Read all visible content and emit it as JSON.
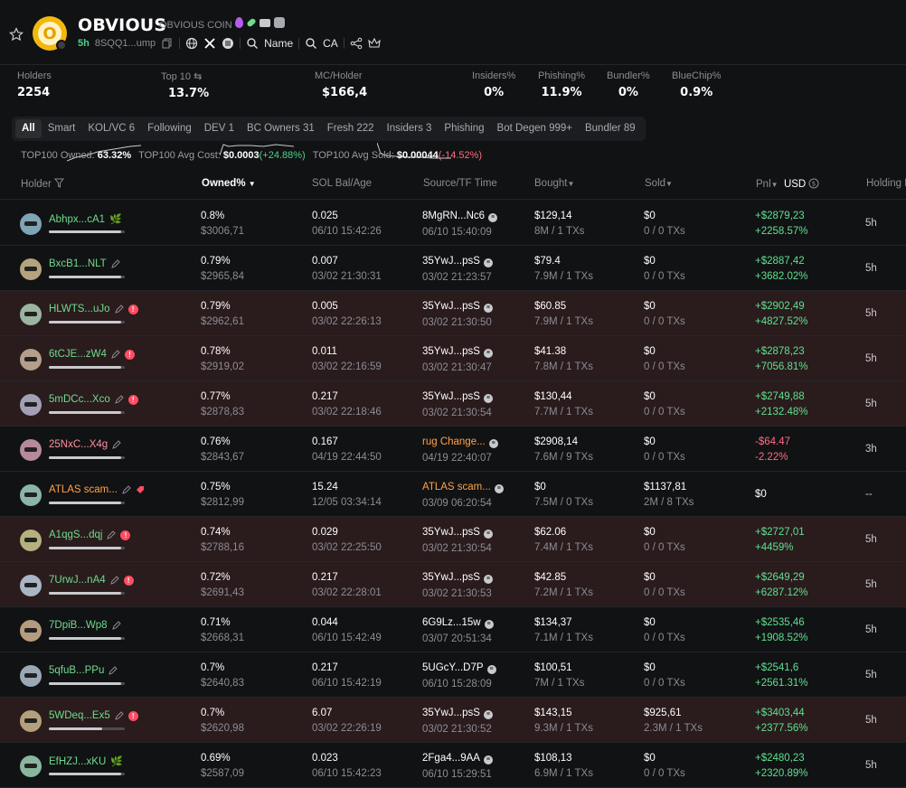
{
  "token": {
    "name": "OBVIOUS",
    "subtitle": "OBVIOUS COIN",
    "logo_letter": "O",
    "age": "5h",
    "address": "8SQQ1...ump",
    "links": {
      "name_label": "Name",
      "ca_label": "CA"
    }
  },
  "stats": {
    "holders": {
      "label": "Holders",
      "value": "2254"
    },
    "top10": {
      "label": "Top 10",
      "value": "13.7%"
    },
    "mc_holder": {
      "label": "MC/Holder",
      "value": "$166,4"
    },
    "insiders": {
      "label": "Insiders%",
      "value": "0%"
    },
    "phishing": {
      "label": "Phishing%",
      "value": "11.9%"
    },
    "bundler": {
      "label": "Bundler%",
      "value": "0%"
    },
    "bluechip": {
      "label": "BlueChip%",
      "value": "0.9%"
    }
  },
  "tabs": [
    "All",
    "Smart",
    "KOL/VC 6",
    "Following",
    "DEV 1",
    "BC Owners 31",
    "Fresh 222",
    "Insiders 3",
    "Phishing",
    "Bot Degen 999+",
    "Bundler 89"
  ],
  "summary": {
    "owned_label": "TOP100 Owned:",
    "owned_value": "63.32%",
    "avgcost_label": "TOP100 Avg Cost:",
    "avgcost_value": "$0.0003",
    "avgcost_change": "(+24.88%)",
    "avgsold_label": "TOP100 Avg Sold:",
    "avgsold_value": "$0.00044",
    "avgsold_change": "(-14.52%)"
  },
  "columns": {
    "holder": "Holder",
    "owned": "Owned%",
    "sol": "SOL Bal/Age",
    "source": "Source/TF Time",
    "bought": "Bought",
    "sold": "Sold",
    "pnl": "Pnl",
    "usd": "USD",
    "holding": "Holding Pe"
  },
  "rows": [
    {
      "name": "Abhpx...cA1",
      "color": "green",
      "badge": "leaf",
      "red": false,
      "bar": 0.95,
      "owned": "0.8%",
      "owned_usd": "$3006,71",
      "sol": "0.025",
      "sol_age": "06/10 15:42:26",
      "src": "8MgRN...Nc6",
      "src_color": "",
      "src_time": "06/10 15:40:09",
      "bought": "$129,14",
      "bought_sub": "8M / 1 TXs",
      "sold": "$0",
      "sold_sub": "0 / 0 TXs",
      "pnl": "+$2879,23",
      "pnl_pct": "+2258.57%",
      "pnl_color": "g",
      "hold": "5h"
    },
    {
      "name": "BxcB1...NLT",
      "color": "green",
      "badge": "pen",
      "red": false,
      "bar": 0.95,
      "owned": "0.79%",
      "owned_usd": "$2965,84",
      "sol": "0.007",
      "sol_age": "03/02 21:30:31",
      "src": "35YwJ...psS",
      "src_color": "",
      "src_time": "03/02 21:23:57",
      "bought": "$79.4",
      "bought_sub": "7.9M / 1 TXs",
      "sold": "$0",
      "sold_sub": "0 / 0 TXs",
      "pnl": "+$2887,42",
      "pnl_pct": "+3682.02%",
      "pnl_color": "g",
      "hold": "5h"
    },
    {
      "name": "HLWTS...uJo",
      "color": "green",
      "badge": "flag",
      "red": true,
      "bar": 0.95,
      "owned": "0.79%",
      "owned_usd": "$2962,61",
      "sol": "0.005",
      "sol_age": "03/02 22:26:13",
      "src": "35YwJ...psS",
      "src_color": "",
      "src_time": "03/02 21:30:50",
      "bought": "$60.85",
      "bought_sub": "7.9M / 1 TXs",
      "sold": "$0",
      "sold_sub": "0 / 0 TXs",
      "pnl": "+$2902,49",
      "pnl_pct": "+4827.52%",
      "pnl_color": "g",
      "hold": "5h"
    },
    {
      "name": "6tCJE...zW4",
      "color": "green",
      "badge": "flag",
      "red": true,
      "bar": 0.95,
      "owned": "0.78%",
      "owned_usd": "$2919,02",
      "sol": "0.011",
      "sol_age": "03/02 22:16:59",
      "src": "35YwJ...psS",
      "src_color": "",
      "src_time": "03/02 21:30:47",
      "bought": "$41.38",
      "bought_sub": "7.8M / 1 TXs",
      "sold": "$0",
      "sold_sub": "0 / 0 TXs",
      "pnl": "+$2878,23",
      "pnl_pct": "+7056.81%",
      "pnl_color": "g",
      "hold": "5h"
    },
    {
      "name": "5mDCc...Xco",
      "color": "green",
      "badge": "flag",
      "red": true,
      "bar": 0.95,
      "owned": "0.77%",
      "owned_usd": "$2878,83",
      "sol": "0.217",
      "sol_age": "03/02 22:18:46",
      "src": "35YwJ...psS",
      "src_color": "",
      "src_time": "03/02 21:30:54",
      "bought": "$130,44",
      "bought_sub": "7.7M / 1 TXs",
      "sold": "$0",
      "sold_sub": "0 / 0 TXs",
      "pnl": "+$2749,88",
      "pnl_pct": "+2132.48%",
      "pnl_color": "g",
      "hold": "5h"
    },
    {
      "name": "25NxC...X4g",
      "color": "pink",
      "badge": "pen",
      "red": false,
      "bar": 0.95,
      "owned": "0.76%",
      "owned_usd": "$2843,67",
      "sol": "0.167",
      "sol_age": "04/19 22:44:50",
      "src": "rug Change...",
      "src_color": "o",
      "src_time": "04/19 22:40:07",
      "bought": "$2908,14",
      "bought_sub": "7.6M / 9 TXs",
      "sold": "$0",
      "sold_sub": "0 / 0 TXs",
      "pnl": "-$64.47",
      "pnl_pct": "-2.22%",
      "pnl_color": "r",
      "hold": "3h"
    },
    {
      "name": "ATLAS scam...",
      "color": "orange",
      "badge": "tag",
      "red": false,
      "bar": 0.95,
      "owned": "0.75%",
      "owned_usd": "$2812,99",
      "sol": "15.24",
      "sol_age": "12/05 03:34:14",
      "src": "ATLAS scam...",
      "src_color": "o",
      "src_time": "03/09 06:20:54",
      "bought": "$0",
      "bought_sub": "7.5M / 0 TXs",
      "sold": "$1137,81",
      "sold_sub": "2M / 8 TXs",
      "pnl": "$0",
      "pnl_pct": "",
      "pnl_color": "",
      "hold": "--"
    },
    {
      "name": "A1qgS...dqj",
      "color": "green",
      "badge": "flag",
      "red": true,
      "bar": 0.95,
      "owned": "0.74%",
      "owned_usd": "$2788,16",
      "sol": "0.029",
      "sol_age": "03/02 22:25:50",
      "src": "35YwJ...psS",
      "src_color": "",
      "src_time": "03/02 21:30:54",
      "bought": "$62.06",
      "bought_sub": "7.4M / 1 TXs",
      "sold": "$0",
      "sold_sub": "0 / 0 TXs",
      "pnl": "+$2727,01",
      "pnl_pct": "+4459%",
      "pnl_color": "g",
      "hold": "5h"
    },
    {
      "name": "7UrwJ...nA4",
      "color": "green",
      "badge": "flag",
      "red": true,
      "bar": 0.95,
      "owned": "0.72%",
      "owned_usd": "$2691,43",
      "sol": "0.217",
      "sol_age": "03/02 22:28:01",
      "src": "35YwJ...psS",
      "src_color": "",
      "src_time": "03/02 21:30:53",
      "bought": "$42.85",
      "bought_sub": "7.2M / 1 TXs",
      "sold": "$0",
      "sold_sub": "0 / 0 TXs",
      "pnl": "+$2649,29",
      "pnl_pct": "+6287.12%",
      "pnl_color": "g",
      "hold": "5h"
    },
    {
      "name": "7DpiB...Wp8",
      "color": "green",
      "badge": "pen",
      "red": false,
      "bar": 0.95,
      "owned": "0.71%",
      "owned_usd": "$2668,31",
      "sol": "0.044",
      "sol_age": "06/10 15:42:49",
      "src": "6G9Lz...15w",
      "src_color": "",
      "src_time": "03/07 20:51:34",
      "bought": "$134,37",
      "bought_sub": "7.1M / 1 TXs",
      "sold": "$0",
      "sold_sub": "0 / 0 TXs",
      "pnl": "+$2535,46",
      "pnl_pct": "+1908.52%",
      "pnl_color": "g",
      "hold": "5h"
    },
    {
      "name": "5qfuB...PPu",
      "color": "green",
      "badge": "pen",
      "red": false,
      "bar": 0.95,
      "owned": "0.7%",
      "owned_usd": "$2640,83",
      "sol": "0.217",
      "sol_age": "06/10 15:42:19",
      "src": "5UGcY...D7P",
      "src_color": "",
      "src_time": "06/10 15:28:09",
      "bought": "$100,51",
      "bought_sub": "7M / 1 TXs",
      "sold": "$0",
      "sold_sub": "0 / 0 TXs",
      "pnl": "+$2541,6",
      "pnl_pct": "+2561.31%",
      "pnl_color": "g",
      "hold": "5h"
    },
    {
      "name": "5WDeq...Ex5",
      "color": "green",
      "badge": "flag",
      "red": true,
      "bar": 0.7,
      "owned": "0.7%",
      "owned_usd": "$2620,98",
      "sol": "6.07",
      "sol_age": "03/02 22:26:19",
      "src": "35YwJ...psS",
      "src_color": "",
      "src_time": "03/02 21:30:52",
      "bought": "$143,15",
      "bought_sub": "9.3M / 1 TXs",
      "sold": "$925,61",
      "sold_sub": "2.3M / 1 TXs",
      "pnl": "+$3403,44",
      "pnl_pct": "+2377.56%",
      "pnl_color": "g",
      "hold": "5h"
    },
    {
      "name": "EfHZJ...xKU",
      "color": "green",
      "badge": "leaf",
      "red": false,
      "bar": 0.95,
      "owned": "0.69%",
      "owned_usd": "$2587,09",
      "sol": "0.023",
      "sol_age": "06/10 15:42:23",
      "src": "2Fga4...9AA",
      "src_color": "",
      "src_time": "06/10 15:29:51",
      "bought": "$108,13",
      "bought_sub": "6.9M / 1 TXs",
      "sold": "$0",
      "sold_sub": "0 / 0 TXs",
      "pnl": "+$2480,23",
      "pnl_pct": "+2320.89%",
      "pnl_color": "g",
      "hold": "5h"
    }
  ]
}
